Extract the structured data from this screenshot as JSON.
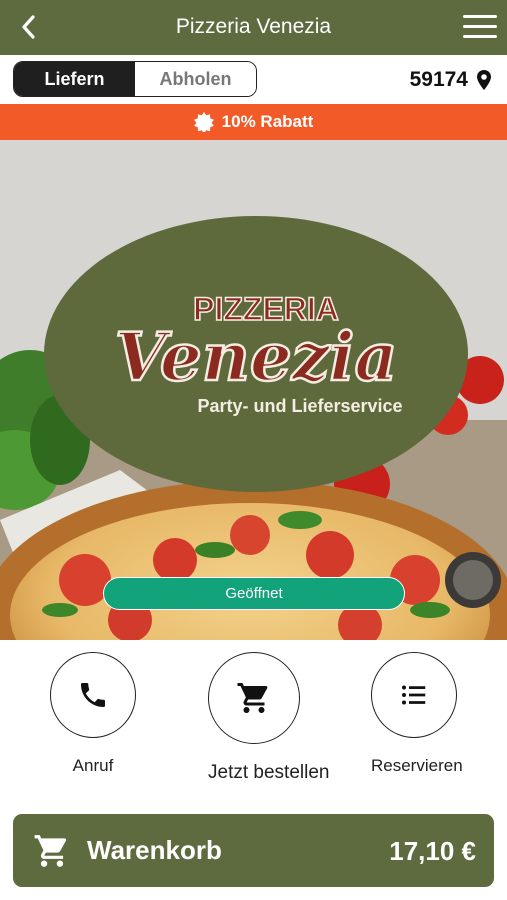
{
  "header": {
    "title": "Pizzeria Venezia",
    "back_icon": "chevron-left-icon",
    "menu_icon": "hamburger-menu-icon",
    "color": "#5d6b3f"
  },
  "mode": {
    "options": [
      "Liefern",
      "Abholen"
    ],
    "selected": "Liefern",
    "zip": "59174",
    "zip_icon": "location-pin-icon"
  },
  "promo": {
    "text": "10% Rabatt",
    "icon": "badge-star-icon",
    "color": "#f25a28"
  },
  "hero": {
    "logo": {
      "line1": "PIZZERIA",
      "line2": "Venezia",
      "tagline": "Party- und Lieferservice"
    },
    "status": "Geöffnet",
    "status_color": "#12a37a"
  },
  "actions": [
    {
      "label": "Anruf",
      "icon": "phone-icon"
    },
    {
      "label": "Jetzt bestellen",
      "icon": "shopping-cart-icon"
    },
    {
      "label": "Reservieren",
      "icon": "list-icon"
    }
  ],
  "cart": {
    "label": "Warenkorb",
    "total": "17,10 €",
    "icon": "shopping-cart-icon"
  }
}
